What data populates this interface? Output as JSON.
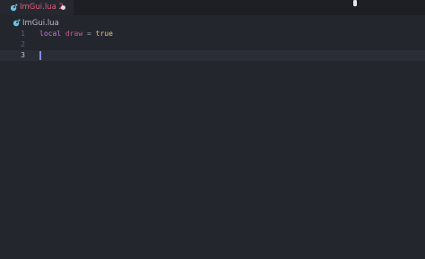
{
  "tab": {
    "label": "ImGui.lua 2",
    "icon": "lua-file-icon",
    "modified": true
  },
  "breadcrumb": {
    "label": "ImGui.lua",
    "icon": "lua-file-icon"
  },
  "editor": {
    "active_line": 3,
    "lines": [
      {
        "number": "1",
        "tokens": [
          {
            "text": "local",
            "kind": "kw"
          },
          {
            "text": " ",
            "kind": "ws"
          },
          {
            "text": "draw",
            "kind": "ident"
          },
          {
            "text": " = ",
            "kind": "op"
          },
          {
            "text": "true",
            "kind": "lit"
          }
        ]
      },
      {
        "number": "2",
        "tokens": []
      },
      {
        "number": "3",
        "tokens": []
      }
    ]
  },
  "colors": {
    "background": "#24262d",
    "tab_label": "#e25b7a",
    "keyword": "#c678dd",
    "identifier": "#c95b8f",
    "literal": "#e9c46a",
    "caret": "#7e8cff"
  }
}
